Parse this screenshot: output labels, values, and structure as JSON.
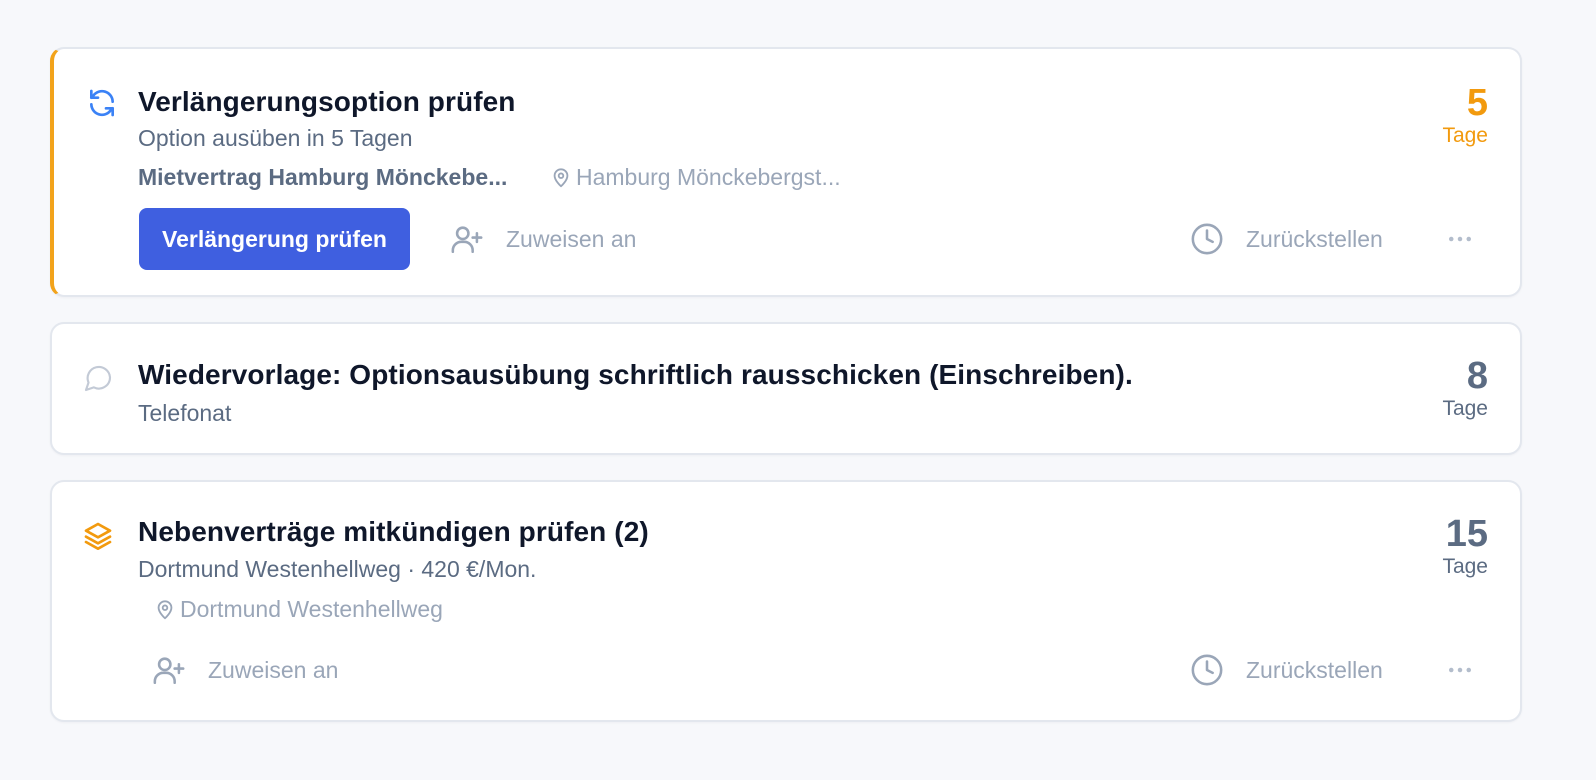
{
  "tasks": [
    {
      "icon": "refresh-icon",
      "accent_color": "#f2a31b",
      "title": "Verlängerungsoption prüfen",
      "subtitle": "Option ausüben in 5 Tagen",
      "contract": "Mietvertrag Hamburg Mönckebe...",
      "location": "Hamburg Mönckebergst...",
      "days": "5",
      "days_unit": "Tage",
      "primary_action": "Verlängerung prüfen",
      "assign_label": "Zuweisen an",
      "snooze_label": "Zurückstellen"
    },
    {
      "icon": "chat-bubble-icon",
      "title": "Wiedervorlage: Optionsausübung schriftlich rausschicken (Einschreiben).",
      "subtitle": "Telefonat",
      "days": "8",
      "days_unit": "Tage"
    },
    {
      "icon": "layers-icon",
      "title": "Nebenverträge mitkündigen prüfen (2)",
      "subtitle": "Dortmund Westenhellweg · 420 €/Mon.",
      "location": "Dortmund Westenhellweg",
      "days": "15",
      "days_unit": "Tage",
      "assign_label": "Zuweisen an",
      "snooze_label": "Zurückstellen"
    }
  ],
  "colors": {
    "primary": "#3f5fe0",
    "urgent": "#f29a0e",
    "muted": "#9aa6b8",
    "secondary_text": "#5b6b82"
  }
}
